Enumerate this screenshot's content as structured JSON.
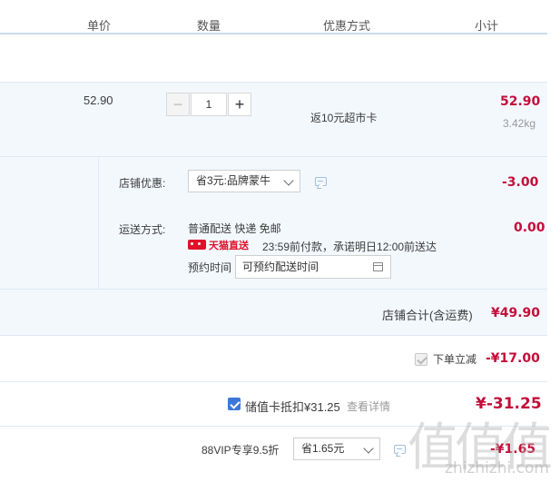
{
  "header": {
    "unit_price": "单价",
    "quantity": "数量",
    "promotion": "优惠方式",
    "subtotal": "小计"
  },
  "item": {
    "unit_price": "52.90",
    "quantity": "1",
    "minus_glyph": "−",
    "plus_glyph": "+",
    "promotion": "返10元超市卡",
    "subtotal": "52.90",
    "weight": "3.42kg"
  },
  "store": {
    "discount_label": "店铺优惠:",
    "discount_select": "省3元:品牌蒙牛",
    "discount_amount": "-3.00",
    "delivery_label": "运送方式:",
    "delivery_method": "普通配送 快递 免邮",
    "delivery_fee": "0.00",
    "tmall_logo_text": "天猫直送",
    "delivery_promise": "23:59前付款，承诺明日12:00前送达",
    "appointment_label": "预约时间",
    "appointment_placeholder": "可预约配送时间",
    "total_label": "店铺合计(含运费)",
    "total_value": "¥49.90"
  },
  "order_discount": {
    "label": "下单立减",
    "value": "-¥17.00",
    "checked": true,
    "disabled": true
  },
  "stored_value_card": {
    "label": "储值卡抵扣¥31.25",
    "details_link": "查看详情",
    "value": "¥-31.25",
    "checked": true
  },
  "vip": {
    "label": "88VIP专享9.5折",
    "select": "省1.65元",
    "value": "-¥1.65"
  },
  "watermark": {
    "text": "值值值",
    "url": "zhizhizhi.com"
  },
  "colors": {
    "accent_red": "#c40e3a",
    "band_blue": "#f3f8fd",
    "checkbox_blue": "#3c78d8",
    "link_gray": "#999999"
  }
}
